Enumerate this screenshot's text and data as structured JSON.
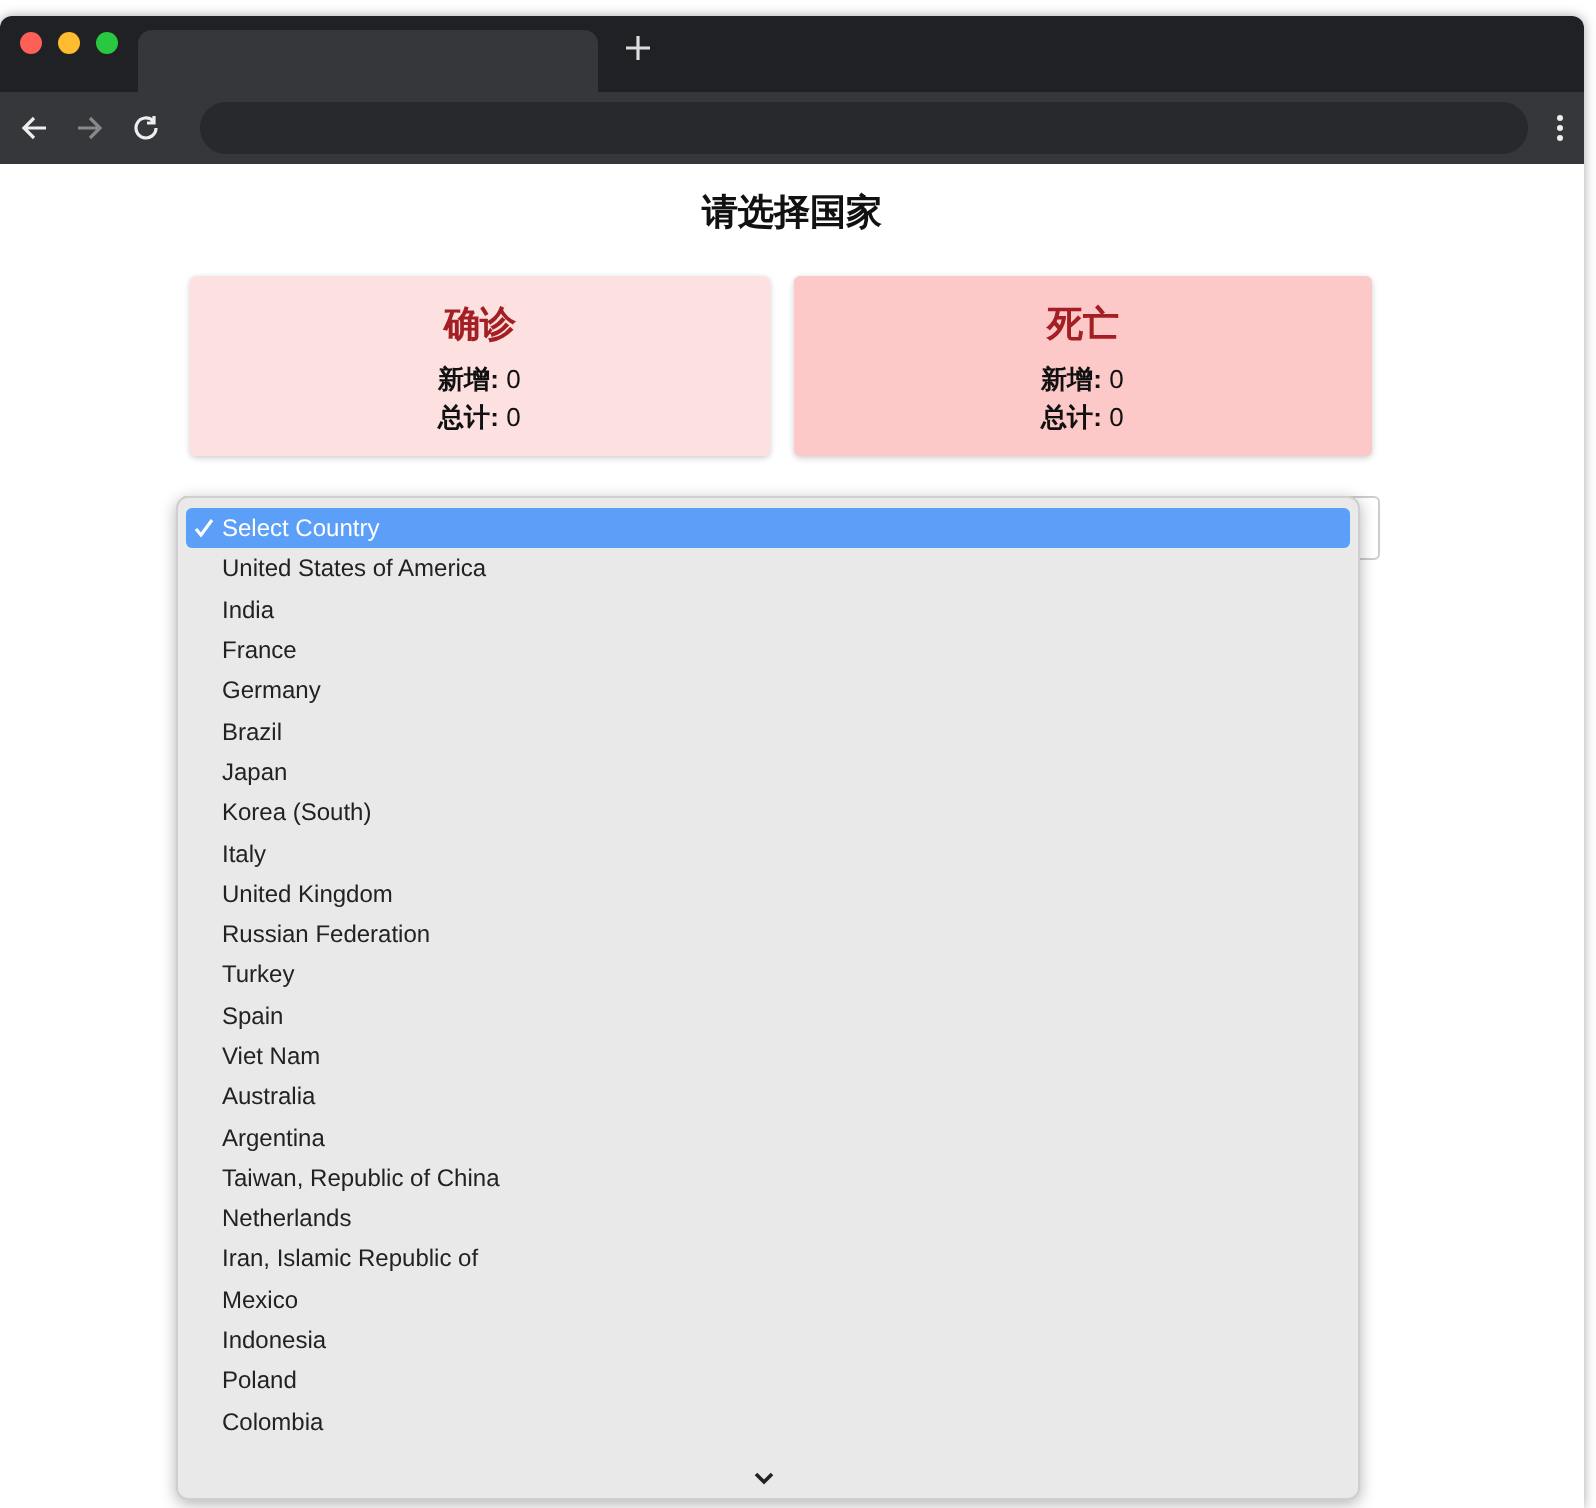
{
  "page": {
    "title": "请选择国家"
  },
  "cards": [
    {
      "title": "确诊",
      "color": "#fde0e0",
      "rows": [
        {
          "label": "新增:",
          "value": "0"
        },
        {
          "label": "总计:",
          "value": "0"
        }
      ]
    },
    {
      "title": "死亡",
      "color": "#fcc8c8",
      "rows": [
        {
          "label": "新增:",
          "value": "0"
        },
        {
          "label": "总计:",
          "value": "0"
        }
      ]
    }
  ],
  "dropdown": {
    "options": [
      {
        "label": "Select Country",
        "selected": true
      },
      {
        "label": "United States of America",
        "selected": false
      },
      {
        "label": "India",
        "selected": false
      },
      {
        "label": "France",
        "selected": false
      },
      {
        "label": "Germany",
        "selected": false
      },
      {
        "label": "Brazil",
        "selected": false
      },
      {
        "label": "Japan",
        "selected": false
      },
      {
        "label": "Korea (South)",
        "selected": false
      },
      {
        "label": "Italy",
        "selected": false
      },
      {
        "label": "United Kingdom",
        "selected": false
      },
      {
        "label": "Russian Federation",
        "selected": false
      },
      {
        "label": "Turkey",
        "selected": false
      },
      {
        "label": "Spain",
        "selected": false
      },
      {
        "label": "Viet Nam",
        "selected": false
      },
      {
        "label": "Australia",
        "selected": false
      },
      {
        "label": "Argentina",
        "selected": false
      },
      {
        "label": "Taiwan, Republic of China",
        "selected": false
      },
      {
        "label": "Netherlands",
        "selected": false
      },
      {
        "label": "Iran, Islamic Republic of",
        "selected": false
      },
      {
        "label": "Mexico",
        "selected": false
      },
      {
        "label": "Indonesia",
        "selected": false
      },
      {
        "label": "Poland",
        "selected": false
      },
      {
        "label": "Colombia",
        "selected": false
      }
    ]
  }
}
